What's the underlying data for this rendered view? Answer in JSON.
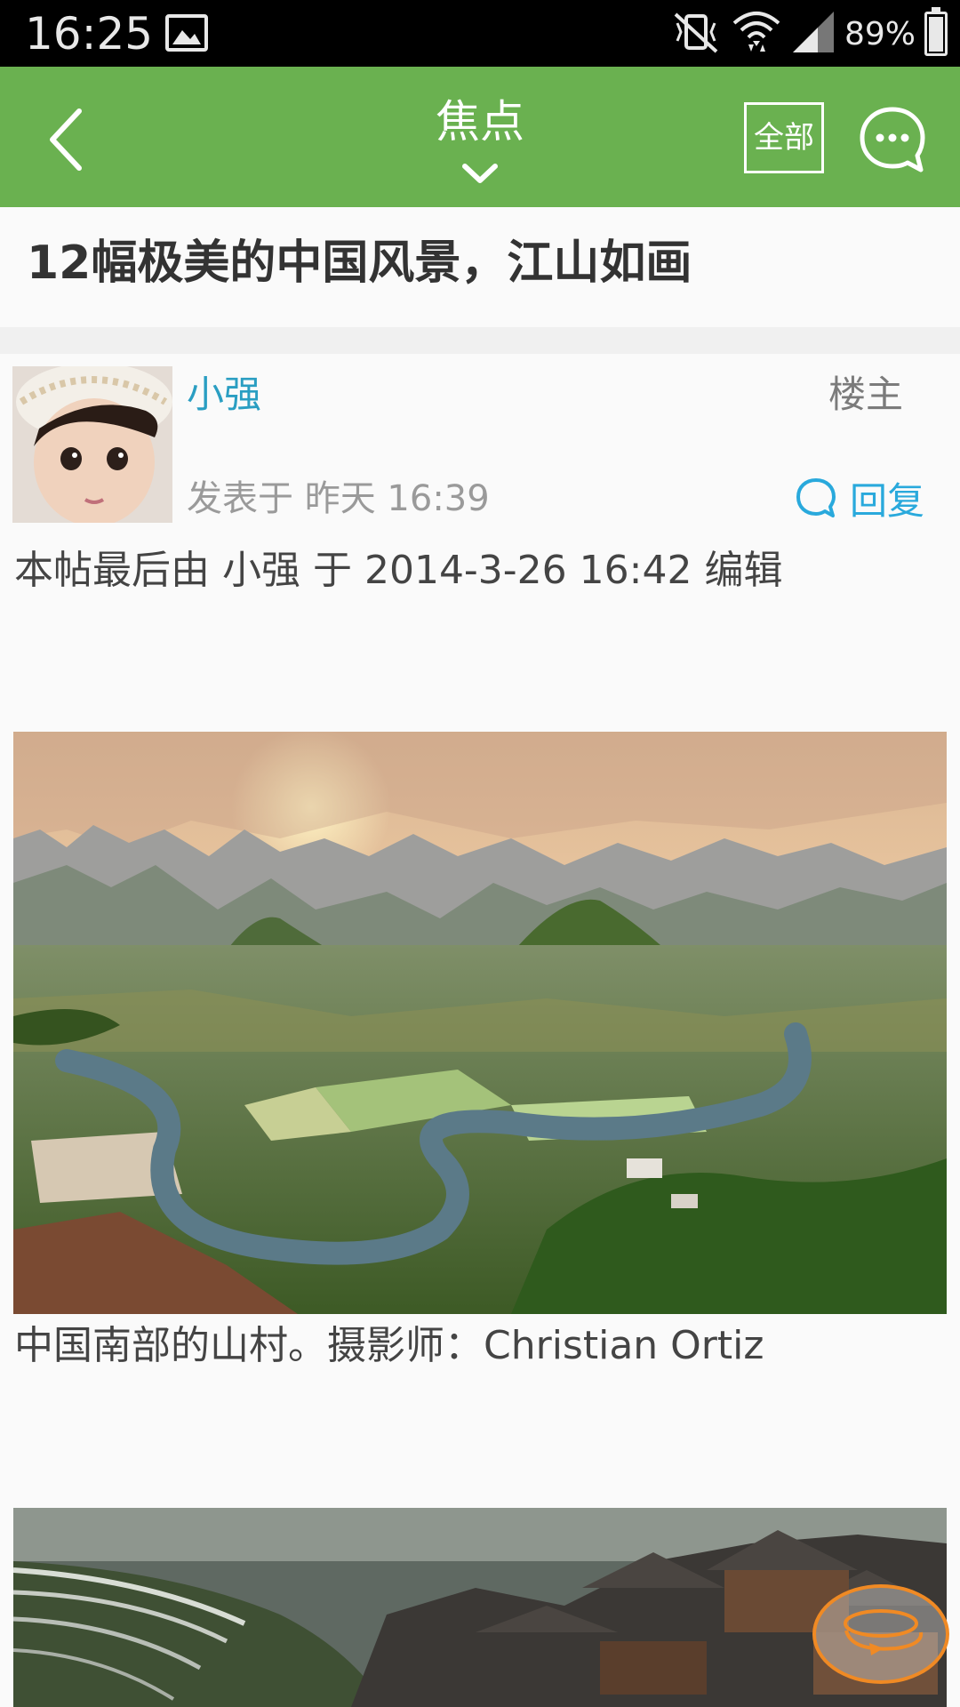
{
  "status_bar": {
    "time": "16:25",
    "battery_percent": "89%",
    "battery_level": 0.89,
    "icons": [
      "image-icon",
      "vibrate-icon",
      "wifi-icon",
      "signal-icon",
      "battery-icon"
    ]
  },
  "header": {
    "title": "焦点",
    "all_label": "全部",
    "background_color": "#6ab150"
  },
  "post": {
    "title": "12幅极美的中国风景，江山如画",
    "author": "小强",
    "floor": "楼主",
    "time": "发表于 昨天 16:39",
    "reply_label": "回复",
    "edit_note": "本帖最后由 小强 于 2014-3-26 16:42 编辑",
    "caption_1": "中国南部的山村。摄影师：Christian Ortiz"
  },
  "colors": {
    "author_name": "#2a9ec2",
    "reply": "#29a9dc",
    "float_button_ring": "#f08a24"
  }
}
